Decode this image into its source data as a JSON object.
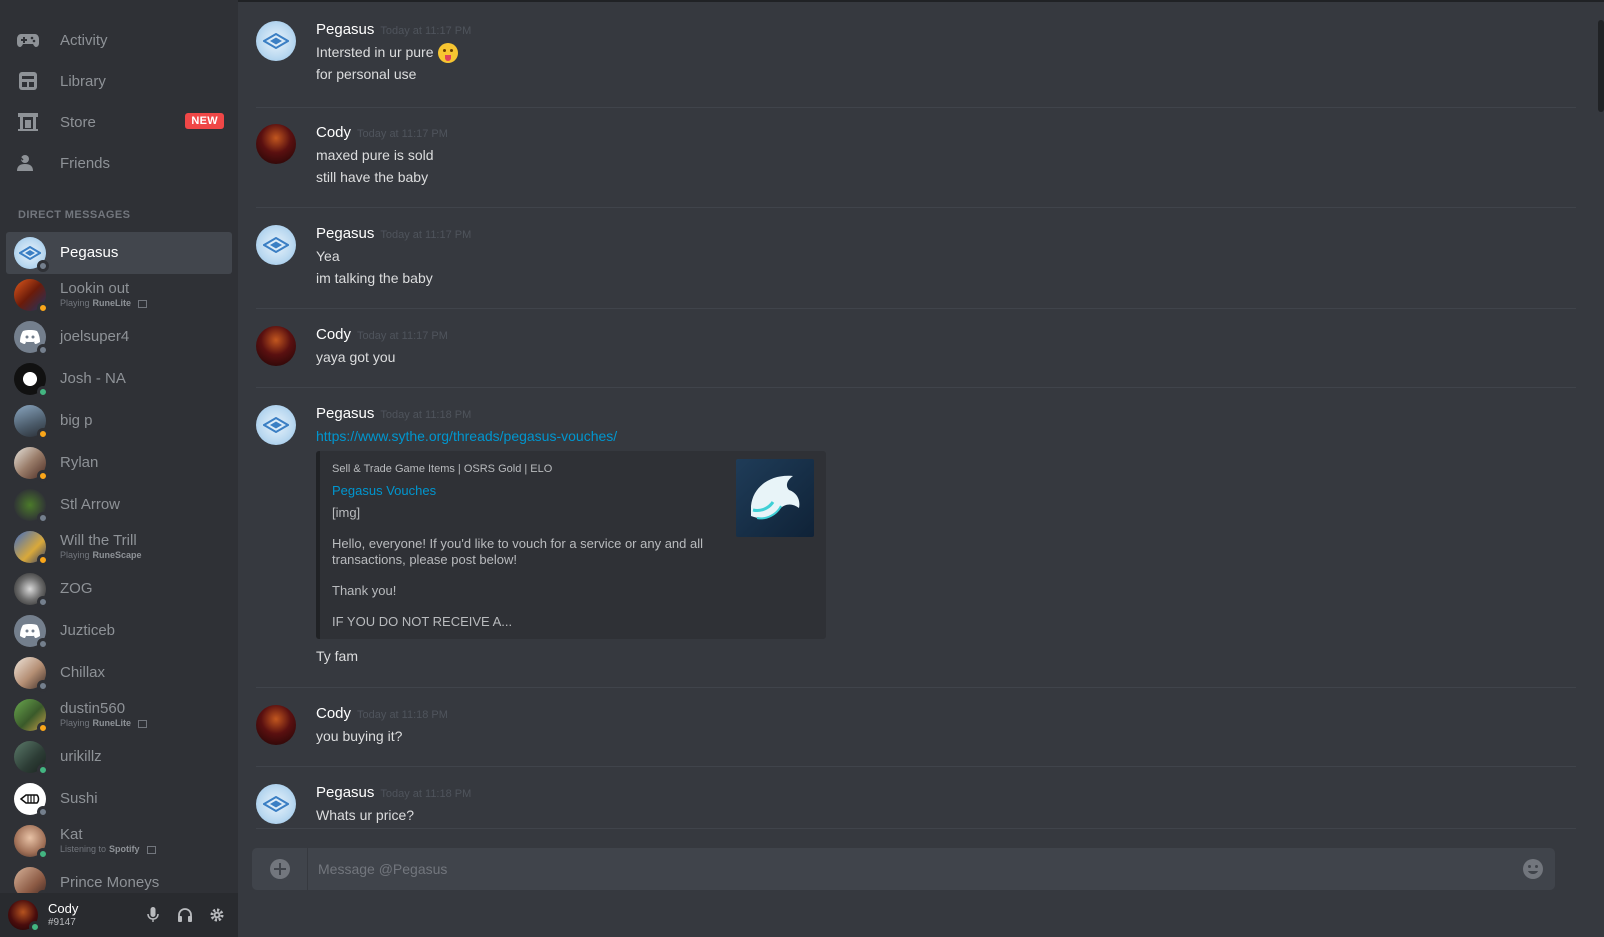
{
  "nav": [
    {
      "label": "Activity",
      "icon": "gamepad-icon"
    },
    {
      "label": "Library",
      "icon": "library-icon"
    },
    {
      "label": "Store",
      "icon": "store-icon",
      "badge": "NEW"
    },
    {
      "label": "Friends",
      "icon": "friends-icon"
    }
  ],
  "dm_header": "DIRECT MESSAGES",
  "dms": [
    {
      "name": "Pegasus",
      "status": "offline",
      "active": true
    },
    {
      "name": "Lookin out",
      "status": "idle",
      "sub_prefix": "Playing",
      "sub_bold": "RuneLite"
    },
    {
      "name": "joelsuper4",
      "status": "offline"
    },
    {
      "name": "Josh - NA",
      "status": "online"
    },
    {
      "name": "big p",
      "status": "idle"
    },
    {
      "name": "Rylan",
      "status": "idle"
    },
    {
      "name": "Stl Arrow",
      "status": "offline"
    },
    {
      "name": "Will the Trill",
      "status": "idle",
      "sub_prefix": "Playing",
      "sub_bold": "RuneScape"
    },
    {
      "name": "ZOG",
      "status": "offline"
    },
    {
      "name": "Juzticeb",
      "status": "offline"
    },
    {
      "name": "Chillax",
      "status": "offline"
    },
    {
      "name": "dustin560",
      "status": "idle",
      "sub_prefix": "Playing",
      "sub_bold": "RuneLite"
    },
    {
      "name": "urikillz",
      "status": "online"
    },
    {
      "name": "Sushi",
      "status": "offline"
    },
    {
      "name": "Kat",
      "status": "online",
      "sub_prefix": "Listening to",
      "sub_bold": "Spotify"
    },
    {
      "name": "Prince Moneys",
      "status": "online"
    }
  ],
  "user": {
    "name": "Cody",
    "tag": "#9147"
  },
  "messages": {
    "m1": {
      "author": "Pegasus",
      "time": "Today at 11:17 PM",
      "line1": "Intersted in ur pure",
      "line2": "for personal use"
    },
    "m2": {
      "author": "Cody",
      "time": "Today at 11:17 PM",
      "line1": "maxed pure is sold",
      "line2": "still have the baby"
    },
    "m3": {
      "author": "Pegasus",
      "time": "Today at 11:17 PM",
      "line1": "Yea",
      "line2": "im talking the baby"
    },
    "m4": {
      "author": "Cody",
      "time": "Today at 11:17 PM",
      "line1": "yaya got you"
    },
    "m5": {
      "author": "Pegasus",
      "time": "Today at 11:18 PM",
      "link": "https://www.sythe.org/threads/pegasus-vouches/",
      "embed": {
        "provider": "Sell & Trade Game Items | OSRS Gold | ELO",
        "title": "Pegasus Vouches",
        "img": "[img]",
        "desc1": "Hello, everyone! If you'd like to vouch for a service or any and all transactions, please post below!",
        "desc2": "Thank you!",
        "desc3": "IF YOU DO NOT RECEIVE A..."
      },
      "line_after": "Ty fam"
    },
    "m6": {
      "author": "Cody",
      "time": "Today at 11:18 PM",
      "line1": "you buying it?"
    },
    "m7": {
      "author": "Pegasus",
      "time": "Today at 11:18 PM",
      "line1": "Whats ur price?"
    }
  },
  "composer": {
    "placeholder": "Message @Pegasus"
  },
  "colors": {
    "online": "#43b581",
    "idle": "#faa61a",
    "offline": "#747f8d",
    "link": "#0096cf",
    "badge": "#f04747"
  }
}
